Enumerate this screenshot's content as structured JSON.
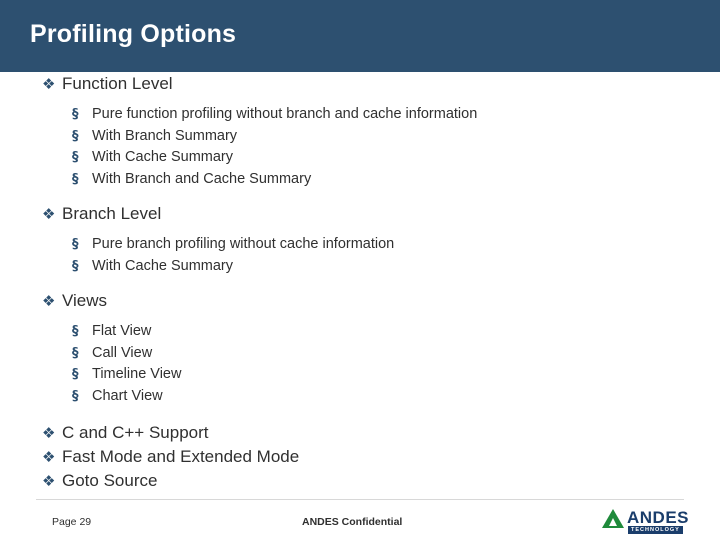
{
  "slide": {
    "title": "Profiling Options",
    "title_bar_color": "#2d5070",
    "bullet_level1_glyph": "❖",
    "bullet_level2_glyph": "§",
    "content": [
      {
        "level": 1,
        "text": "Function Level",
        "children": [
          "Pure function profiling without branch and cache information",
          "With Branch Summary",
          "With Cache Summary",
          "With Branch and Cache Summary"
        ]
      },
      {
        "level": 1,
        "text": "Branch Level",
        "children": [
          "Pure branch profiling without cache information",
          "With Cache Summary"
        ]
      },
      {
        "level": 1,
        "text": "Views",
        "children": [
          "Flat View",
          "Call View",
          "Timeline View",
          "Chart View"
        ]
      },
      {
        "level": 1,
        "text": "C and C++ Support",
        "children": []
      },
      {
        "level": 1,
        "text": "Fast Mode and Extended Mode",
        "children": []
      },
      {
        "level": 1,
        "text": "Goto Source",
        "children": []
      }
    ]
  },
  "footer": {
    "page_label": "Page 29",
    "confidential_label": "ANDES Confidential",
    "logo_word": "ANDES",
    "logo_sub": "TECHNOLOGY"
  }
}
